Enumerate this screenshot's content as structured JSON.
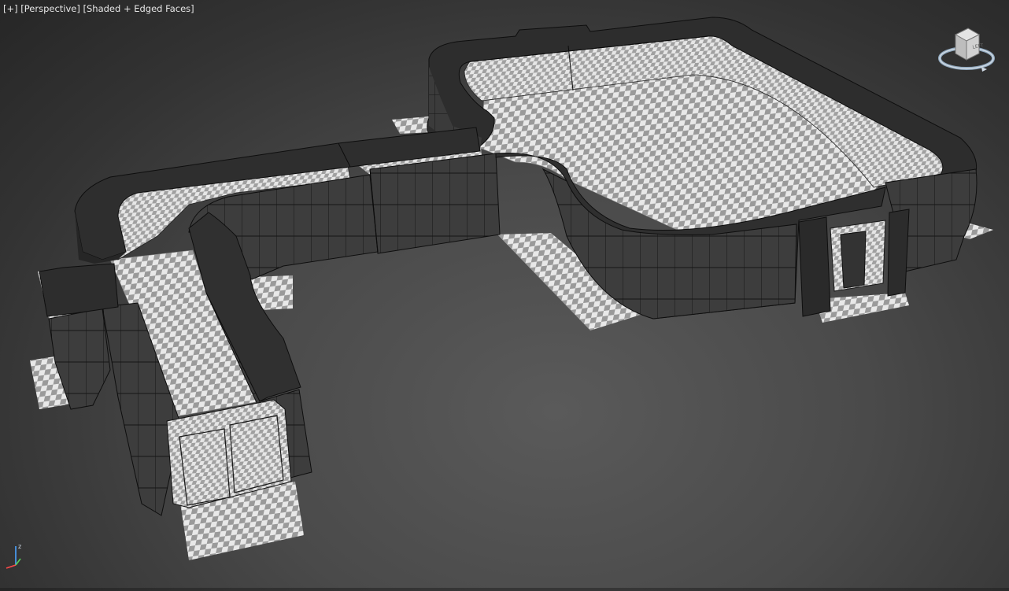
{
  "viewport": {
    "label_plus": "[+]",
    "label_view": "[Perspective]",
    "label_shading": "[Shaded + Edged Faces]"
  },
  "viewcube": {
    "face_label": "LEFT",
    "icon": "viewcube-icon"
  },
  "axis_tripod": {
    "z_label": "z",
    "icon": "axis-tripod-icon"
  },
  "colors": {
    "background": "#4a4a4a",
    "wall_dark": "#3a3a3a",
    "wall_top": "#2f2f2f",
    "edge": "#111111",
    "checker_light": "#e8e8e8",
    "checker_dark": "#9a9a9a",
    "axis_blue": "#4aa3ff",
    "axis_red": "#ff4a4a",
    "axis_green": "#5ad45a"
  }
}
